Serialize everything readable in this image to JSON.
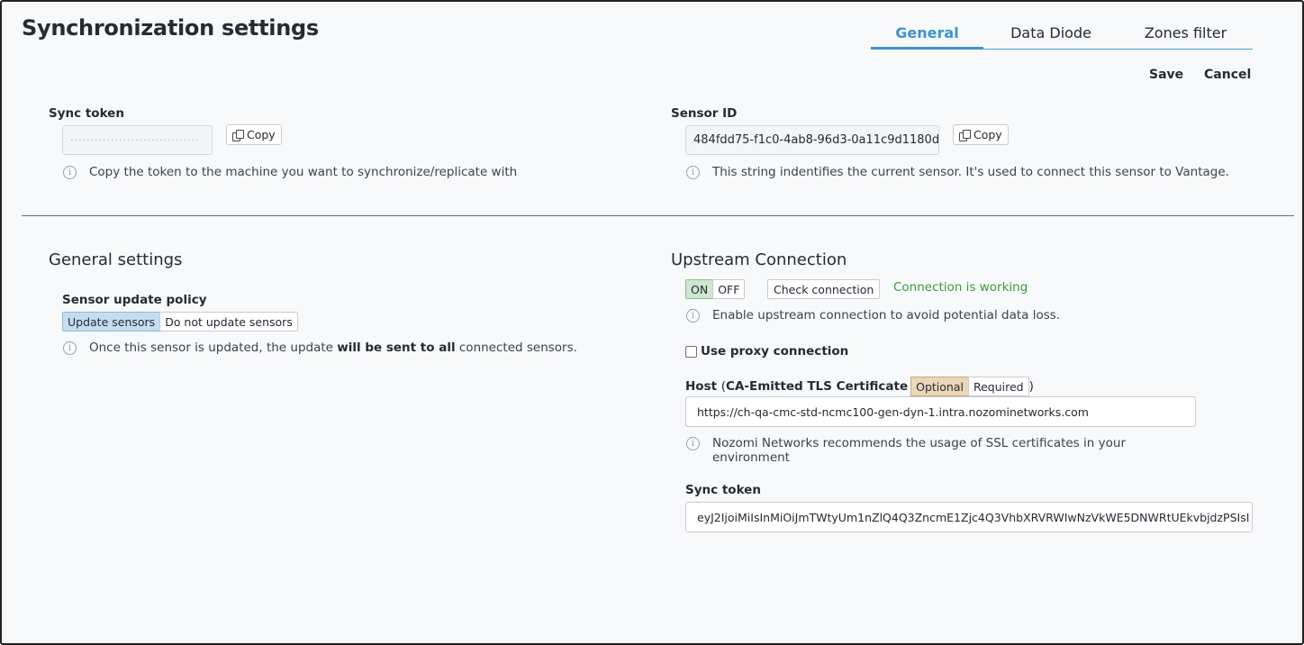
{
  "page": {
    "title": "Synchronization settings"
  },
  "tabs": [
    {
      "label": "General",
      "active": true
    },
    {
      "label": "Data Diode",
      "active": false
    },
    {
      "label": "Zones filter",
      "active": false
    }
  ],
  "actions": {
    "save_label": "Save",
    "cancel_label": "Cancel"
  },
  "sync_token_section": {
    "label": "Sync token",
    "value_mask": "································",
    "copy_label": "Copy",
    "hint": "Copy the token to the machine you want to synchronize/replicate with"
  },
  "sensor_id_section": {
    "label": "Sensor ID",
    "value": "484fdd75-f1c0-4ab8-96d3-0a11c9d1180d",
    "copy_label": "Copy",
    "hint": "This string indentifies the current sensor. It's used to connect this sensor to Vantage."
  },
  "general_settings": {
    "title": "General settings",
    "policy_label": "Sensor update policy",
    "options": [
      "Update sensors",
      "Do not update sensors"
    ],
    "selected": "Update sensors",
    "hint_prefix": "Once this sensor is updated, the update ",
    "hint_bold": "will be sent to all",
    "hint_suffix": " connected sensors."
  },
  "upstream": {
    "title": "Upstream Connection",
    "toggle_on": "ON",
    "toggle_off": "OFF",
    "toggle_state": "ON",
    "check_label": "Check connection",
    "status": "Connection is working",
    "status_color": "#3a9a3a",
    "hint": "Enable upstream connection to avoid potential data loss.",
    "proxy_label": "Use proxy connection",
    "proxy_checked": false,
    "host_label": "Host",
    "host_paren_open": "(",
    "host_cert_label": "CA-Emitted TLS Certificate",
    "cert_options": [
      "Optional",
      "Required"
    ],
    "cert_selected": "Optional",
    "host_paren_close": ")",
    "host_value": "https://ch-qa-cmc-std-ncmc100-gen-dyn-1.intra.nozominetworks.com",
    "ssl_hint": "Nozomi Networks recommends the usage of SSL certificates in your environment",
    "token_label": "Sync token",
    "token_value": "eyJ2IjoiMiIsInMiOiJmTWtyUm1nZlQ4Q3ZncmE1Zjc4Q3VhbXRVRWIwNzVkWE5DNWRtUEkvbjdzPSIsI"
  },
  "colors": {
    "accent": "#3d93c8",
    "selected_blue": "#c5ddf2",
    "selected_green": "#cfe6cf",
    "selected_tan": "#ecd6b8"
  }
}
